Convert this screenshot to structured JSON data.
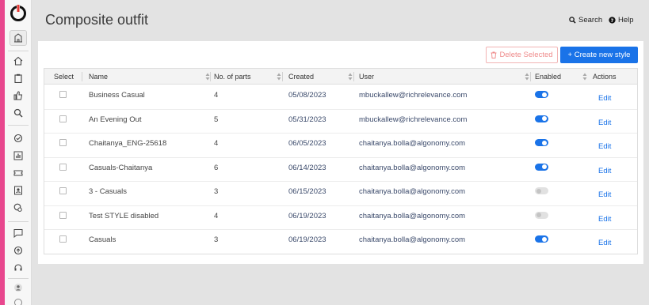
{
  "nav": {
    "icons": [
      "building-icon",
      "home-icon",
      "clipboard-icon",
      "thumbs-up-icon",
      "search-icon",
      "check-badge-icon",
      "bar-chart-icon",
      "ticket-icon",
      "contact-card-icon",
      "tag-search-icon",
      "chat-icon",
      "rocket-icon",
      "headset-icon",
      "user-icon",
      "at-icon"
    ]
  },
  "header": {
    "title": "Composite outfit",
    "search_label": "Search",
    "help_label": "Help"
  },
  "toolbar": {
    "delete_label": "Delete Selected",
    "create_label": "+ Create new style"
  },
  "table": {
    "columns": [
      "Select",
      "Name",
      "No. of parts",
      "Created",
      "User",
      "Enabled",
      "Actions"
    ],
    "rows": [
      {
        "name": "Business Casual",
        "parts": "4",
        "created": "05/08/2023",
        "user": "mbuckallew@richrelevance.com",
        "enabled": true,
        "action": "Edit"
      },
      {
        "name": "An Evening Out",
        "parts": "5",
        "created": "05/31/2023",
        "user": "mbuckallew@richrelevance.com",
        "enabled": true,
        "action": "Edit"
      },
      {
        "name": "Chaitanya_ENG-25618",
        "parts": "4",
        "created": "06/05/2023",
        "user": "chaitanya.bolla@algonomy.com",
        "enabled": true,
        "action": "Edit"
      },
      {
        "name": "Casuals-Chaitanya",
        "parts": "6",
        "created": "06/14/2023",
        "user": "chaitanya.bolla@algonomy.com",
        "enabled": true,
        "action": "Edit"
      },
      {
        "name": "3 - Casuals",
        "parts": "3",
        "created": "06/15/2023",
        "user": "chaitanya.bolla@algonomy.com",
        "enabled": false,
        "action": "Edit"
      },
      {
        "name": "Test STYLE disabled",
        "parts": "4",
        "created": "06/19/2023",
        "user": "chaitanya.bolla@algonomy.com",
        "enabled": false,
        "action": "Edit"
      },
      {
        "name": "Casuals",
        "parts": "3",
        "created": "06/19/2023",
        "user": "chaitanya.bolla@algonomy.com",
        "enabled": true,
        "action": "Edit"
      }
    ]
  },
  "colors": {
    "accent": "#e8478e",
    "primary": "#1a73e8",
    "danger_light": "#ef8b8b"
  }
}
